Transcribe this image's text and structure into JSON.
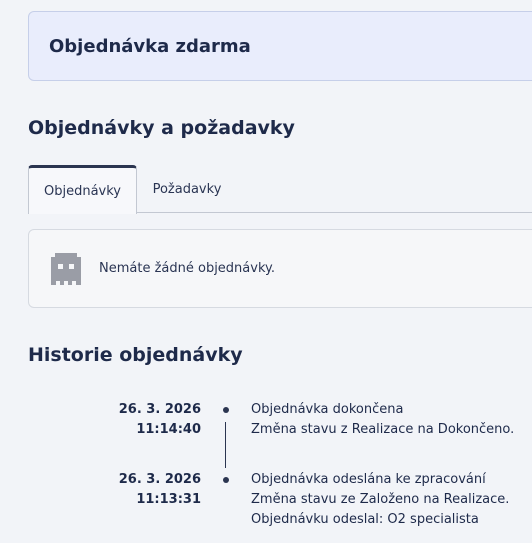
{
  "banner": {
    "title": "Objednávka zdarma"
  },
  "orders_section": {
    "title": "Objednávky a požadavky",
    "tabs": [
      {
        "label": "Objednávky",
        "active": true
      },
      {
        "label": "Požadavky",
        "active": false
      }
    ],
    "empty_state": {
      "icon": "ghost-icon",
      "text": "Nemáte žádné objednávky."
    }
  },
  "history": {
    "title": "Historie objednávky",
    "events": [
      {
        "date": "26. 3. 2026",
        "time": "11:14:40",
        "lines": [
          "Objednávka dokončena",
          "Změna stavu z Realizace na Dokončeno."
        ]
      },
      {
        "date": "26. 3. 2026",
        "time": "11:13:31",
        "lines": [
          "Objednávka odeslána ke zpracování",
          "Změna stavu ze Založeno na Realizace.",
          "Objednávku odeslal: O2 specialista"
        ]
      }
    ]
  }
}
